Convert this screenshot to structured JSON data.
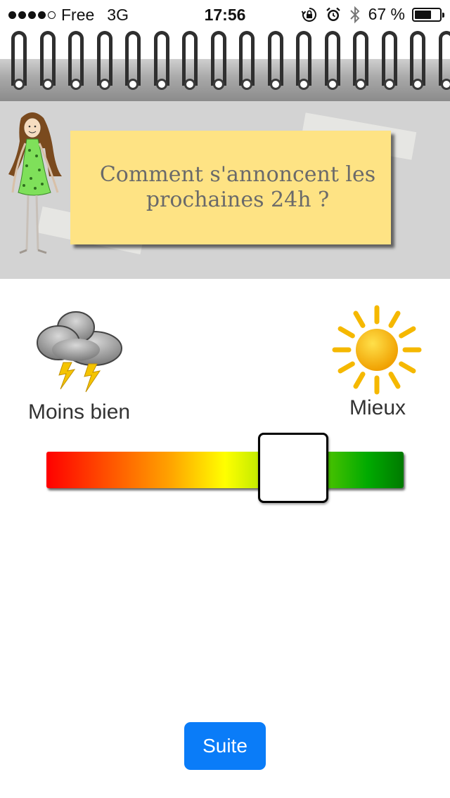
{
  "status_bar": {
    "carrier": "Free",
    "network": "3G",
    "time": "17:56",
    "battery": "67 %",
    "battery_level": 0.67,
    "icons": [
      "signal-dots-icon",
      "rotation-lock-icon",
      "alarm-icon",
      "bluetooth-icon",
      "battery-icon"
    ]
  },
  "note": {
    "line1": "Comment s'annoncent les",
    "line2": "prochaines 24h ?"
  },
  "scale": {
    "left_label": "Moins bien",
    "right_label": "Mieux",
    "left_icon": "storm-cloud-icon",
    "right_icon": "sun-icon",
    "value": 0.6
  },
  "actions": {
    "next_label": "Suite"
  },
  "colors": {
    "note": "#fee384",
    "button": "#0a7cf8",
    "panel": "#d3d3d3"
  }
}
